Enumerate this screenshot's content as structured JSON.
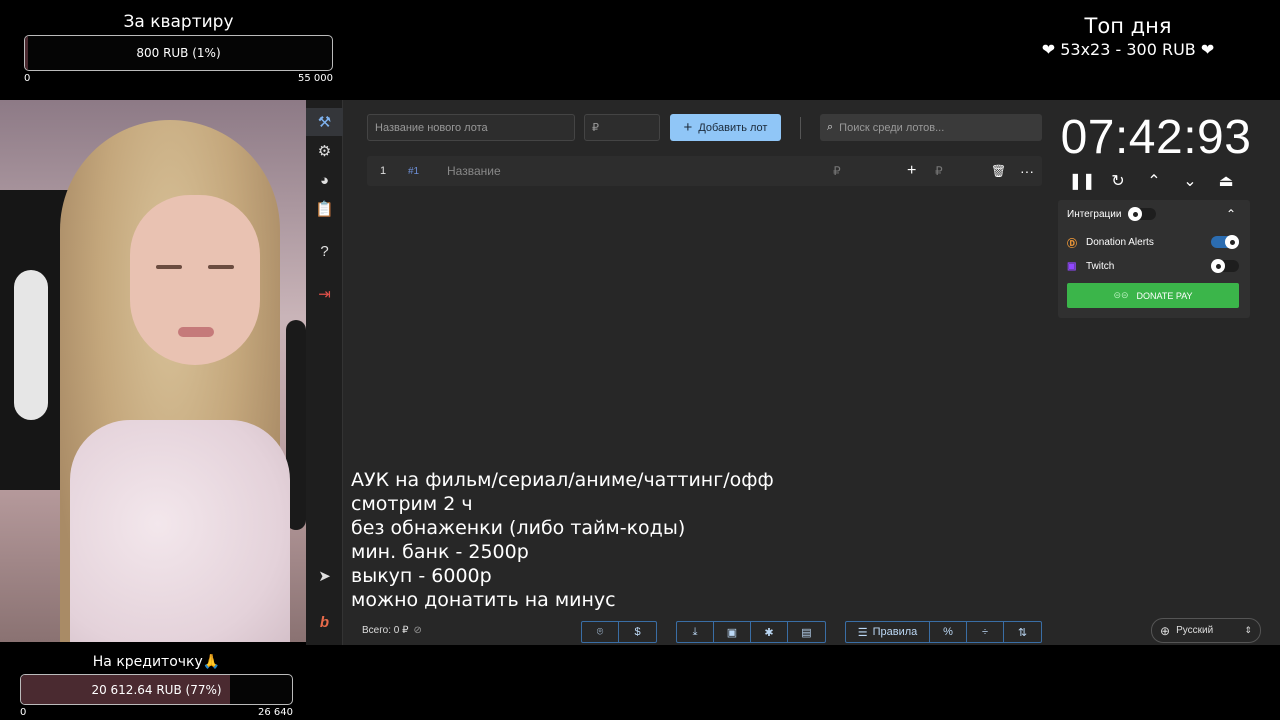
{
  "overlay": {
    "goal_top": {
      "title": "За квартиру",
      "text": "800 RUB (1%)",
      "min": "0",
      "max": "55 000",
      "progress": 0.01
    },
    "top_day": {
      "title": "Топ дня",
      "text": "❤ 53x23 - 300 RUB ❤"
    },
    "goal_bottom": {
      "title": "На кредиточку🙏",
      "text": "20 612.64 RUB (77%)",
      "min": "0",
      "max": "26 640",
      "progress": 0.77
    }
  },
  "sidebar": {
    "items": [
      {
        "name": "auction",
        "icon": "⚒"
      },
      {
        "name": "settings",
        "icon": "⚙"
      },
      {
        "name": "stats",
        "icon": "◕"
      },
      {
        "name": "history",
        "icon": "📋"
      },
      {
        "name": "help",
        "icon": "?"
      },
      {
        "name": "logout",
        "icon": "⇥"
      },
      {
        "name": "telegram",
        "icon": "➤"
      },
      {
        "name": "brand",
        "icon": "b"
      }
    ]
  },
  "toolbar": {
    "lot_name_placeholder": "Название нового лота",
    "amount_placeholder": "₽",
    "add_lot_label": "Добавить лот",
    "search_placeholder": "Поиск среди лотов..."
  },
  "lots": [
    {
      "index": "1",
      "id": "#1",
      "name": "Название",
      "amount": "₽",
      "extra": "₽"
    }
  ],
  "timer": {
    "value": "07:42:93"
  },
  "integrations": {
    "title": "Интеграции",
    "items": [
      {
        "label": "Donation Alerts",
        "on": true
      },
      {
        "label": "Twitch",
        "on": false
      }
    ],
    "donate_label": "DONATE PAY"
  },
  "rules": [
    "АУК на фильм/сериал/аниме/чаттинг/офф",
    "смотрим 2 ч",
    "без обнаженки (либо тайм-коды)",
    "мин. банк - 2500р",
    "выкуп - 6000р",
    "можно донатить на минус"
  ],
  "footer": {
    "total": "Всего: 0 ₽",
    "rules_label": "Правила",
    "language": "Русский"
  },
  "colors": {
    "accent": "#90c6f7",
    "donate": "#3bb54a",
    "goal_fill": "#4a2a30"
  }
}
